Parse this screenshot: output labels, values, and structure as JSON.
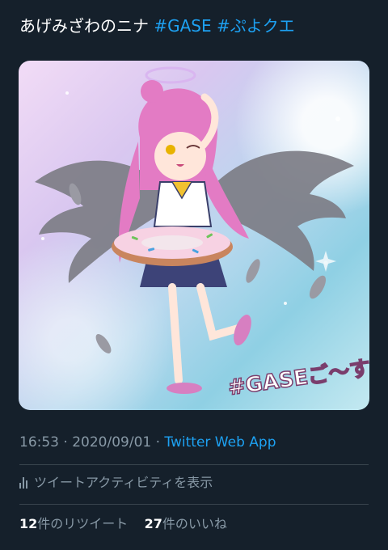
{
  "tweet": {
    "author_text": "あげみざわのニナ",
    "hashtags": [
      "#GASE",
      "#ぷよクエ"
    ]
  },
  "media": {
    "caption": "#GASEご～す",
    "description_icon": "illustration"
  },
  "meta": {
    "time": "16:53",
    "separator": "·",
    "date": "2020/09/01",
    "source": "Twitter Web App"
  },
  "activity": {
    "label": "ツイートアクティビティを表示",
    "icon": "activity-icon"
  },
  "stats": {
    "retweets_count": "12",
    "retweets_label": "件のリツイート",
    "likes_count": "27",
    "likes_label": "件のいいね"
  },
  "colors": {
    "background": "#15202b",
    "accent": "#1da1f2",
    "secondary_text": "#8899a6",
    "divider": "#38444d"
  }
}
